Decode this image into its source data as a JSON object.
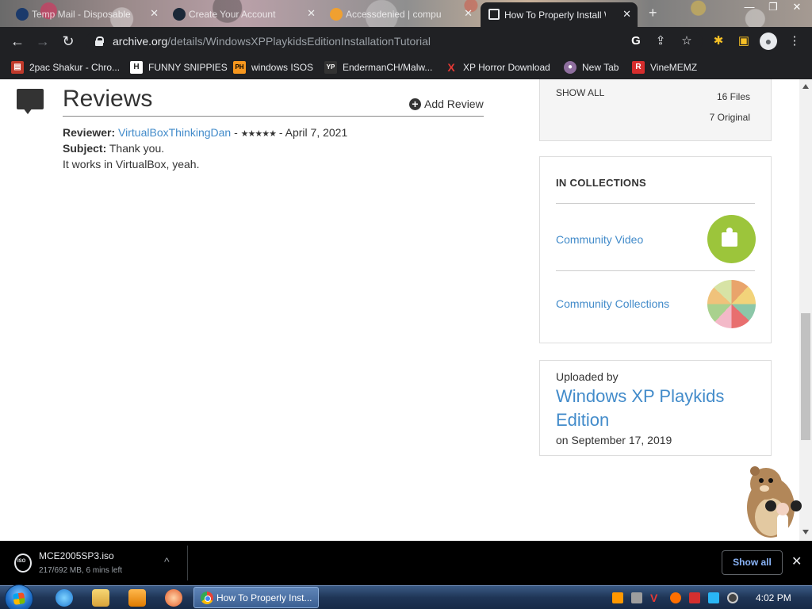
{
  "tabs": [
    {
      "title": "Temp Mail - Disposable",
      "close": "✕",
      "fav_color": "#1b3a6b"
    },
    {
      "title": "Create Your Account",
      "close": "✕",
      "fav_color": "#1b2838"
    },
    {
      "title": "Accessdenied | compu",
      "close": "✕",
      "fav_color": "#f0a030"
    },
    {
      "title": "How To Properly Install W",
      "close": "✕",
      "fav_color": "#ffffff"
    }
  ],
  "new_tab": "+",
  "window_controls": {
    "minimize": "—",
    "maximize": "❐",
    "close": "✕"
  },
  "toolbar": {
    "back": "←",
    "forward": "→",
    "reload": "↻",
    "url_host": "archive.org",
    "url_path": "/details/WindowsXPPlaykidsEditionInstallationTutorial",
    "google_icon": "G",
    "share_icon": "⇪",
    "star_icon": "☆",
    "extensions_icon": "✱",
    "sidepanel_icon": "▣",
    "profile_icon": "●",
    "menu_icon": "⋮"
  },
  "bookmarks": [
    {
      "label": "2pac Shakur - Chro...",
      "icon": "▤",
      "color": "#c0392b"
    },
    {
      "label": "FUNNY SNIPPIES",
      "icon": "H",
      "color": "#222222"
    },
    {
      "label": "windows ISOS",
      "icon": "PH",
      "color": "#f7971e"
    },
    {
      "label": "EndermanCH/Malw...",
      "icon": "YP",
      "color": "#333333"
    },
    {
      "label": "XP Horror Download",
      "icon": "X",
      "color": "#d32f2f"
    },
    {
      "label": "New Tab",
      "icon": "●",
      "color": "#8e6e9e"
    },
    {
      "label": "VineMEMZ",
      "icon": "R",
      "color": "#d62d2d"
    }
  ],
  "reviews": {
    "title": "Reviews",
    "add_review": "Add Review",
    "reviewer_label": "Reviewer:",
    "reviewer_name": "VirtualBoxThinkingDan",
    "reviewer_sep": " - ",
    "stars": "★★★★★",
    "date": " - April 7, 2021",
    "subject_label": "Subject:",
    "subject": " Thank you.",
    "body": "It works in VirtualBox, yeah."
  },
  "files": {
    "show_all": "SHOW ALL",
    "files_count": "16 Files",
    "original_count": "7 Original"
  },
  "collections": {
    "heading": "IN COLLECTIONS",
    "items": [
      {
        "label": "Community Video"
      },
      {
        "label": "Community Collections"
      }
    ]
  },
  "uploader": {
    "label": "Uploaded by",
    "name": "Windows XP Playkids Edition",
    "date": "on September 17, 2019"
  },
  "download": {
    "filename": "MCE2005SP3.iso",
    "status": "217/692 MB, 6 mins left",
    "caret": "^",
    "show_all": "Show all",
    "close": "✕"
  },
  "taskbar": {
    "active_task": "How To Properly Inst...",
    "clock": "4:02 PM"
  }
}
